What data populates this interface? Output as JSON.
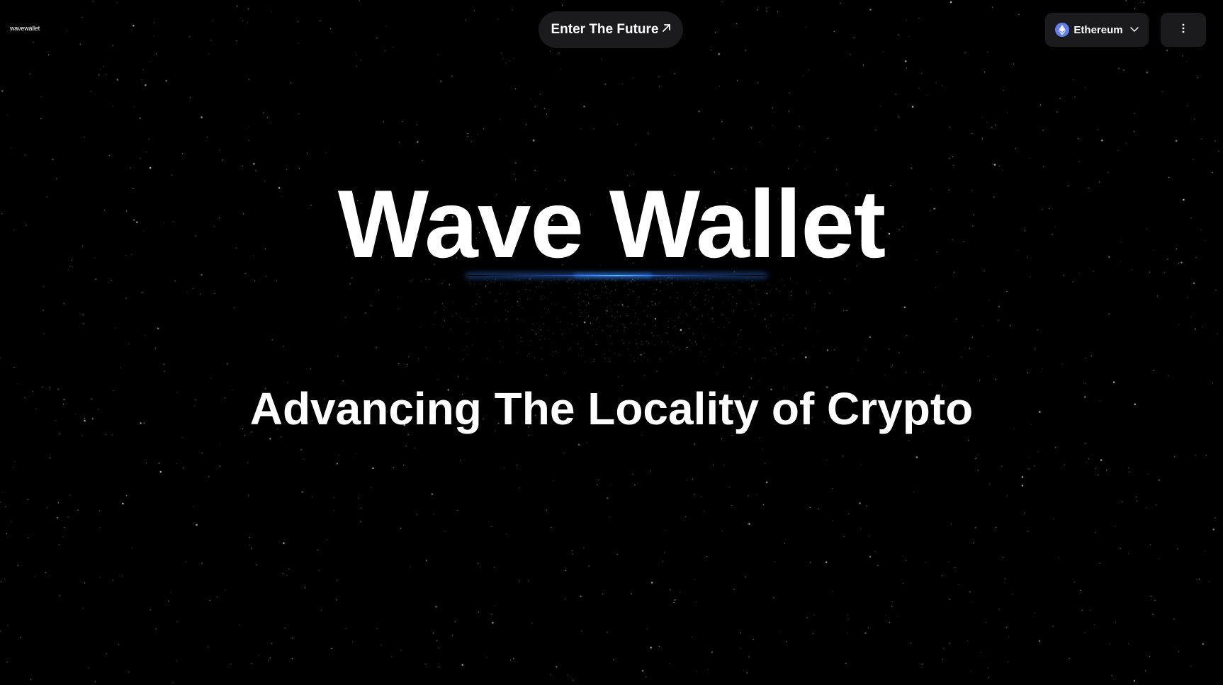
{
  "header": {
    "logo_text": "wavewallet",
    "cta_label": "Enter The Future",
    "cta_icon": "arrow-up-right-icon",
    "network": {
      "label": "Ethereum",
      "icon": "ethereum-icon",
      "dropdown_icon": "chevron-down-icon"
    },
    "menu_icon": "more-vertical-icon"
  },
  "hero": {
    "title": "Wave Wallet",
    "subtitle": "Advancing The Locality of Crypto"
  },
  "colors": {
    "background": "#000000",
    "button_bg": "#1b1b1d",
    "text": "#ffffff",
    "accent_glow": "#3c8cff",
    "ethereum": "#627eea"
  }
}
